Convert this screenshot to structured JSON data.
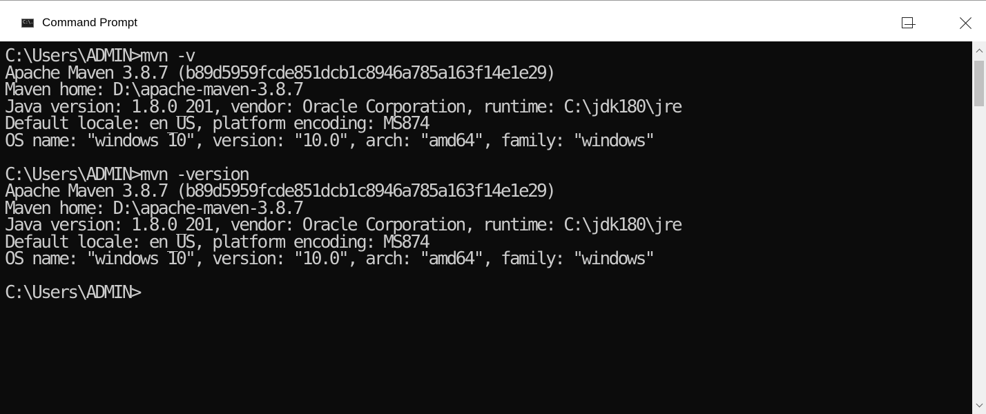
{
  "window": {
    "title": "Command Prompt",
    "icon": "cmd-icon",
    "icon_text": "C:\\."
  },
  "console": {
    "lines": [
      "C:\\Users\\ADMIN>mvn -v",
      "Apache Maven 3.8.7 (b89d5959fcde851dcb1c8946a785a163f14e1e29)",
      "Maven home: D:\\apache-maven-3.8.7",
      "Java version: 1.8.0_201, vendor: Oracle Corporation, runtime: C:\\jdk180\\jre",
      "Default locale: en_US, platform encoding: MS874",
      "OS name: \"windows 10\", version: \"10.0\", arch: \"amd64\", family: \"windows\"",
      "",
      "C:\\Users\\ADMIN>mvn -version",
      "Apache Maven 3.8.7 (b89d5959fcde851dcb1c8946a785a163f14e1e29)",
      "Maven home: D:\\apache-maven-3.8.7",
      "Java version: 1.8.0_201, vendor: Oracle Corporation, runtime: C:\\jdk180\\jre",
      "Default locale: en_US, platform encoding: MS874",
      "OS name: \"windows 10\", version: \"10.0\", arch: \"amd64\", family: \"windows\"",
      "",
      "C:\\Users\\ADMIN>"
    ]
  },
  "colors": {
    "console_background": "#0c0c0c",
    "console_text": "#cccccc",
    "titlebar_background": "#ffffff"
  }
}
